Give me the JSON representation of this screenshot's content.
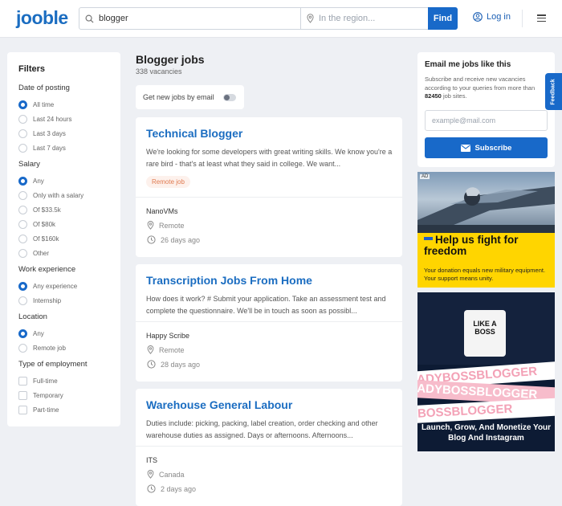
{
  "header": {
    "logo": "jooble",
    "search_value": "blogger",
    "location_placeholder": "In the region...",
    "find_label": "Find",
    "login_label": "Log in"
  },
  "filters": {
    "title": "Filters",
    "groups": [
      {
        "title": "Date of posting",
        "type": "radio",
        "options": [
          "All time",
          "Last 24 hours",
          "Last 3 days",
          "Last 7 days"
        ],
        "selected": 0
      },
      {
        "title": "Salary",
        "type": "radio",
        "options": [
          "Any",
          "Only with a salary",
          "Of $33.5k",
          "Of $80k",
          "Of $160k",
          "Other"
        ],
        "selected": 0
      },
      {
        "title": "Work experience",
        "type": "radio",
        "options": [
          "Any experience",
          "Internship"
        ],
        "selected": 0
      },
      {
        "title": "Location",
        "type": "radio",
        "options": [
          "Any",
          "Remote job"
        ],
        "selected": 0
      },
      {
        "title": "Type of employment",
        "type": "checkbox",
        "options": [
          "Full-time",
          "Temporary",
          "Part-time"
        ],
        "selected": -1
      }
    ]
  },
  "results": {
    "title": "Blogger jobs",
    "count": "338 vacancies",
    "email_toggle_label": "Get new jobs by email"
  },
  "jobs": [
    {
      "title": "Technical Blogger",
      "description": "We're looking for some developers with great writing skills. We know you're a rare bird - that's at least what they said in college. We want...",
      "tag": "Remote job",
      "company": "NanoVMs",
      "location": "Remote",
      "posted": "26 days ago"
    },
    {
      "title": "Transcription Jobs From Home",
      "description": "How does it work? # Submit your application. Take an assessment test and complete the questionnaire. We'll be in touch as soon as possibl...",
      "tag": "",
      "company": "Happy Scribe",
      "location": "Remote",
      "posted": "28 days ago"
    },
    {
      "title": "Warehouse General Labour",
      "description": "Duties include: picking, packing, label creation, order checking and other warehouse duties as assigned. Days or afternoons. Afternoons...",
      "tag": "",
      "company": "ITS",
      "location": "Canada",
      "posted": "2 days ago"
    }
  ],
  "subscribe": {
    "title": "Email me jobs like this",
    "text_before": "Subscribe and receive new vacancies according to your queries from more than ",
    "count": "82450",
    "text_after": " job sites.",
    "email_placeholder": "example@mail.com",
    "button_label": "Subscribe",
    "feedback_label": "Feedback"
  },
  "ads": {
    "label": "AD",
    "ad1_headline": "Help us fight for freedom",
    "ad1_body": "Your donation equals new military equipment. Your support means unity.",
    "ad2_mug": "LIKE A BOSS",
    "ad2_ribbon1": "LADYBOSSBLOGGER",
    "ad2_ribbon2": "LADYBOSSBLOGGER",
    "ad2_ribbon3": "YBOSSBLOGGER",
    "ad2_cta": "Launch, Grow, And Monetize Your Blog And Instagram"
  },
  "colors": {
    "brand": "#1b6dc1",
    "primary_button": "#1869c9",
    "tag_text": "#e07a50",
    "ad_yellow": "#ffd500"
  }
}
